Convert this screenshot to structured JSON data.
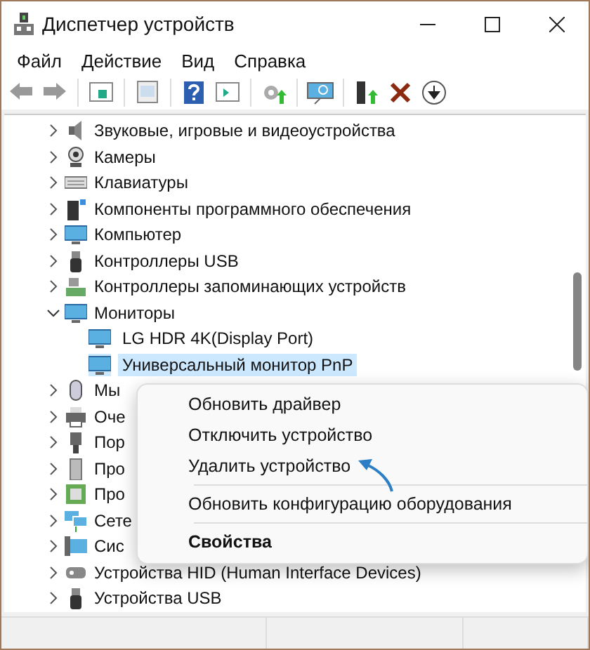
{
  "window": {
    "title": "Диспетчер устройств"
  },
  "menu": [
    "Файл",
    "Действие",
    "Вид",
    "Справка"
  ],
  "tree": [
    {
      "label": "Звуковые, игровые и видеоустройства",
      "expanded": false
    },
    {
      "label": "Камеры",
      "expanded": false
    },
    {
      "label": "Клавиатуры",
      "expanded": false
    },
    {
      "label": "Компоненты программного обеспечения",
      "expanded": false
    },
    {
      "label": "Компьютер",
      "expanded": false
    },
    {
      "label": "Контроллеры USB",
      "expanded": false
    },
    {
      "label": "Контроллеры запоминающих устройств",
      "expanded": false
    },
    {
      "label": "Мониторы",
      "expanded": true,
      "children": [
        {
          "label": "LG HDR 4K(Display Port)",
          "selected": false
        },
        {
          "label": "Универсальный монитор PnP",
          "selected": true
        }
      ]
    },
    {
      "label": "Мы",
      "expanded": false
    },
    {
      "label": "Оче",
      "expanded": false
    },
    {
      "label": "Пор",
      "expanded": false
    },
    {
      "label": "Про",
      "expanded": false
    },
    {
      "label": "Про",
      "expanded": false
    },
    {
      "label": "Сете",
      "expanded": false
    },
    {
      "label": "Сис",
      "expanded": false
    },
    {
      "label": "Устройства HID (Human Interface Devices)",
      "expanded": false
    },
    {
      "label": "Устройства USB",
      "expanded": false
    }
  ],
  "context_menu": [
    {
      "kind": "item",
      "label": "Обновить драйвер"
    },
    {
      "kind": "item",
      "label": "Отключить устройство"
    },
    {
      "kind": "item",
      "label": "Удалить устройство"
    },
    {
      "kind": "separator"
    },
    {
      "kind": "item",
      "label": "Обновить конфигурацию оборудования"
    },
    {
      "kind": "separator"
    },
    {
      "kind": "default",
      "label": "Свойства"
    }
  ]
}
